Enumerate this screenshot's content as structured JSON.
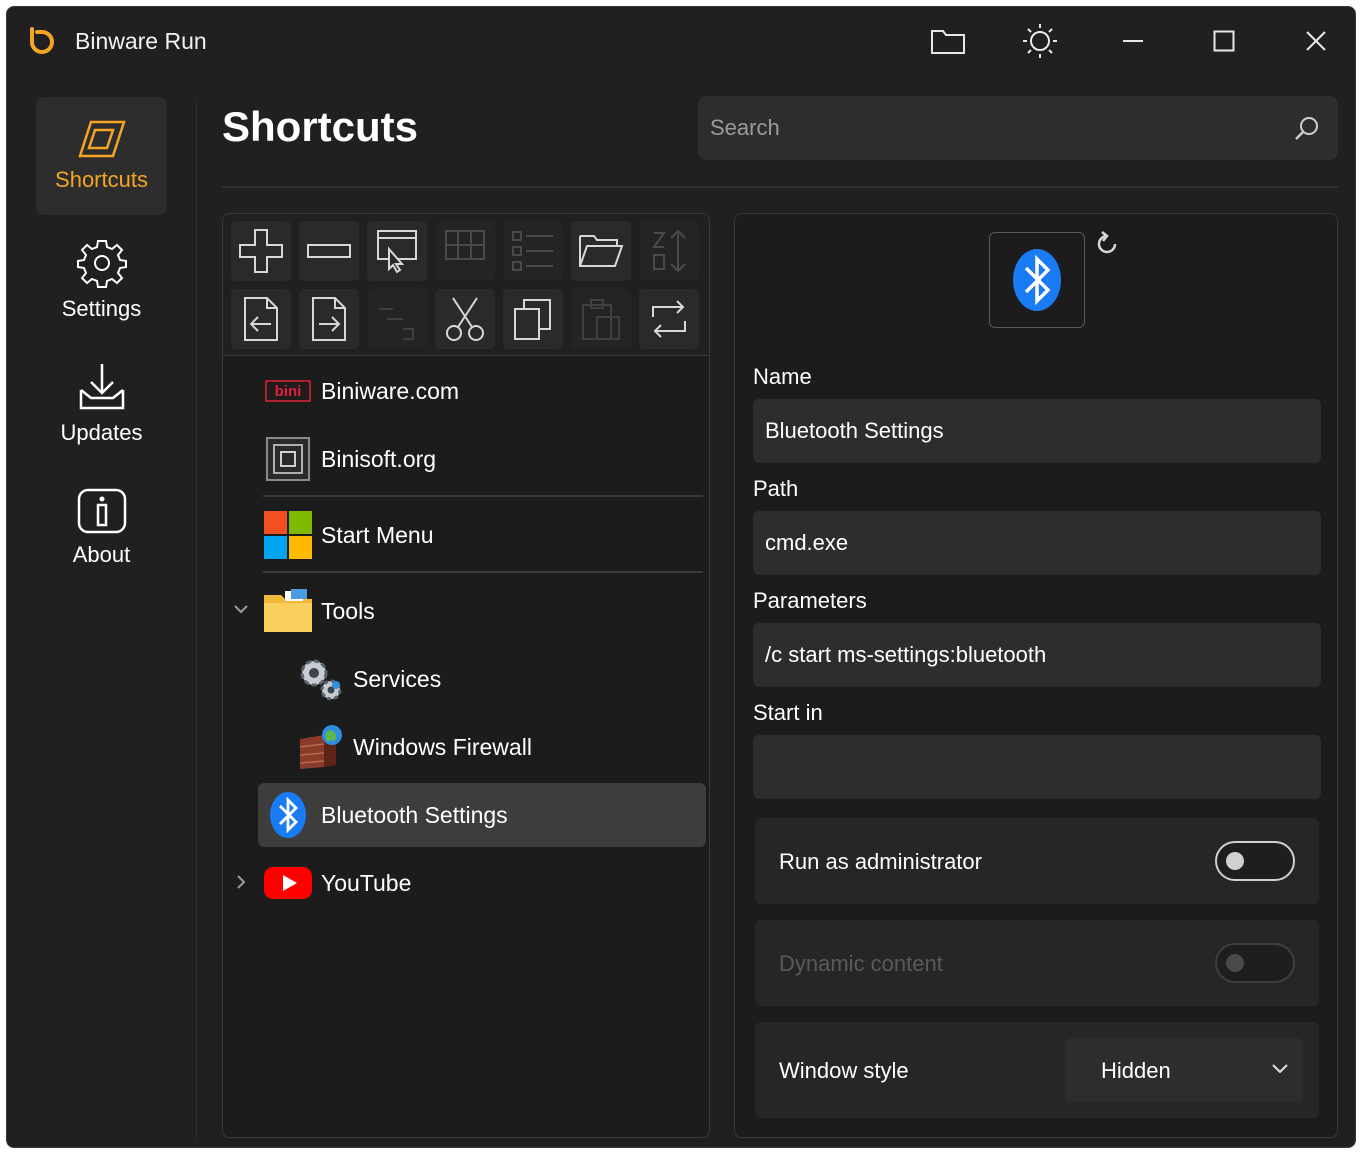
{
  "app": {
    "title": "Binware Run"
  },
  "titlebar": {
    "buttons": [
      "folder-icon",
      "theme-icon",
      "minimize-icon",
      "maximize-icon",
      "close-icon"
    ]
  },
  "nav": {
    "items": [
      {
        "label": "Shortcuts",
        "icon": "shortcuts-icon",
        "active": true
      },
      {
        "label": "Settings",
        "icon": "gear-icon",
        "active": false
      },
      {
        "label": "Updates",
        "icon": "download-icon",
        "active": false
      },
      {
        "label": "About",
        "icon": "info-icon",
        "active": false
      }
    ]
  },
  "header": {
    "title": "Shortcuts",
    "search_placeholder": "Search"
  },
  "toolbar": {
    "row1": [
      {
        "icon": "add-icon",
        "enabled": true
      },
      {
        "icon": "remove-icon",
        "enabled": true
      },
      {
        "icon": "pick-window-icon",
        "enabled": true
      },
      {
        "icon": "grid-pick-icon",
        "enabled": false
      },
      {
        "icon": "list-icon",
        "enabled": false
      },
      {
        "icon": "open-folder-icon",
        "enabled": true
      },
      {
        "icon": "sort-icon",
        "enabled": false
      }
    ],
    "row2": [
      {
        "icon": "import-icon",
        "enabled": true
      },
      {
        "icon": "export-icon",
        "enabled": true
      },
      {
        "icon": "indent-icon",
        "enabled": false
      },
      {
        "icon": "cut-icon",
        "enabled": true
      },
      {
        "icon": "copy-icon",
        "enabled": true
      },
      {
        "icon": "paste-icon",
        "enabled": false
      },
      {
        "icon": "refresh-icon",
        "enabled": true
      }
    ]
  },
  "tree": {
    "items": [
      {
        "label": "Biniware.com",
        "icon": "biniware-logo-icon"
      },
      {
        "label": "Binisoft.org",
        "icon": "binisoft-logo-icon"
      },
      {
        "label": "Start Menu",
        "icon": "windows-logo-icon"
      },
      {
        "label": "Tools",
        "icon": "folder-icon",
        "expanded": true
      },
      {
        "label": "Services",
        "icon": "services-gears-icon"
      },
      {
        "label": "Windows Firewall",
        "icon": "firewall-icon"
      },
      {
        "label": "Bluetooth Settings",
        "icon": "bluetooth-icon",
        "selected": true
      },
      {
        "label": "YouTube",
        "icon": "youtube-icon",
        "expanded": false
      }
    ]
  },
  "details": {
    "icon": "bluetooth-icon",
    "name_label": "Name",
    "name_value": "Bluetooth Settings",
    "path_label": "Path",
    "path_value": "cmd.exe",
    "params_label": "Parameters",
    "params_value": "/c start ms-settings:bluetooth",
    "startin_label": "Start in",
    "startin_value": "",
    "run_admin_label": "Run as administrator",
    "run_admin_on": false,
    "dynamic_label": "Dynamic content",
    "dynamic_on": false,
    "window_style_label": "Window style",
    "window_style_value": "Hidden"
  },
  "colors": {
    "accent": "#f5a524",
    "window_bg": "#202020",
    "panel_bg": "#1c1c1c",
    "bluetooth": "#1a7cf5",
    "youtube": "#ff0000"
  }
}
